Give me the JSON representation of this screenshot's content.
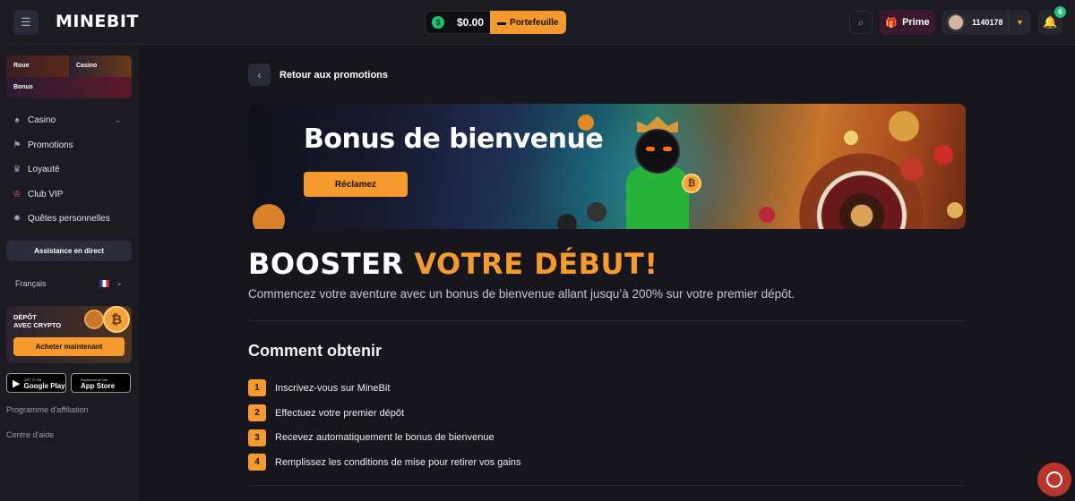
{
  "header": {
    "logo": "MINEBIT",
    "balance": "$0.00",
    "wallet_label": "Portefeuille",
    "prime_label": "Prime",
    "user_id": "1140178",
    "notifications_count": "6"
  },
  "sidebar": {
    "promo_cards": [
      "Roue",
      "Casino",
      "Bonus"
    ],
    "nav": [
      {
        "label": "Casino",
        "icon": "spade-icon"
      },
      {
        "label": "Promotions",
        "icon": "flag-icon"
      },
      {
        "label": "Loyauté",
        "icon": "trophy-icon"
      },
      {
        "label": "Club VIP",
        "icon": "crown-icon"
      },
      {
        "label": "Quêtes personnelles",
        "icon": "settings-icon"
      }
    ],
    "assistance": "Assistance en direct",
    "language": "Français",
    "crypto_banner": {
      "title_line1": "DÉPÔT",
      "title_line2": "AVEC CRYPTO",
      "button": "Acheter maintenant"
    },
    "stores": {
      "google_small": "GET IT ON",
      "google_big": "Google Play",
      "apple_small": "Download on the",
      "apple_big": "App Store"
    },
    "links": [
      "Programme d'affiliation",
      "Centre d'aide"
    ]
  },
  "main": {
    "back_label": "Retour aux promotions",
    "banner_title": "Bonus de bienvenue",
    "banner_button": "Réclamez",
    "hero_title_white": "BOOSTER",
    "hero_title_orange": "VOTRE DÉBUT!",
    "hero_subtitle": "Commencez votre aventure avec un bonus de bienvenue allant jusqu’à 200% sur votre premier dépôt.",
    "section_title": "Comment obtenir",
    "steps": [
      {
        "num": "1",
        "label": "Inscrivez-vous sur MineBit"
      },
      {
        "num": "2",
        "label": "Effectuez votre premier dépôt"
      },
      {
        "num": "3",
        "label": "Recevez automatiquement le bonus de bienvenue"
      },
      {
        "num": "4",
        "label": "Remplissez les conditions de mise pour retirer vos gains"
      }
    ]
  },
  "colors": {
    "accent": "#f59a2f",
    "background": "#16161c",
    "sidebar": "#1b1b21"
  }
}
